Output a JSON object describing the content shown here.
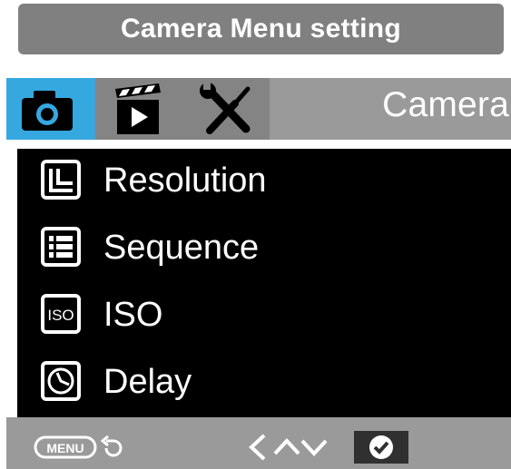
{
  "banner": {
    "title": "Camera Menu setting"
  },
  "tabs": [
    {
      "name": "camera",
      "icon": "camera-icon",
      "active": true
    },
    {
      "name": "video",
      "icon": "clapperboard-icon",
      "active": false
    },
    {
      "name": "setup",
      "icon": "wrench-screwdriver-icon",
      "active": false
    }
  ],
  "header": {
    "active_tab_label": "Camera"
  },
  "menu": {
    "items": [
      {
        "label": "Resolution",
        "icon": "resolution-icon"
      },
      {
        "label": "Sequence",
        "icon": "sequence-icon"
      },
      {
        "label": "ISO",
        "icon": "iso-icon",
        "icon_text": "ISO"
      },
      {
        "label": "Delay",
        "icon": "clock-icon"
      }
    ]
  },
  "footer": {
    "menu_button_label": "MENU",
    "hints": [
      "back-arrow-icon",
      "left-chevron-icon",
      "up-chevron-icon",
      "down-chevron-icon",
      "check-icon"
    ]
  },
  "colors": {
    "active_tab": "#35a8e0",
    "bar": "#9a9a9a",
    "menu_bg": "#000000"
  }
}
